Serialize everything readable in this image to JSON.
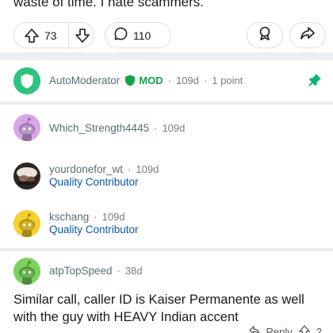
{
  "post": {
    "text_tail": "waste of time. I hate scammers.",
    "upvotes": "73",
    "comments": "110"
  },
  "comments": [
    {
      "username": "AutoModerator",
      "mod_label": "MOD",
      "age": "109d",
      "points": "1 point",
      "pinned": true
    },
    {
      "username": "Which_Strength4445",
      "age": "109d"
    },
    {
      "username": "yourdonefor_wt",
      "age": "109d",
      "flair": "Quality Contributor"
    },
    {
      "username": "kschang",
      "age": "109d",
      "flair": "Quality Contributor"
    },
    {
      "username": "atpTopSpeed",
      "age": "38d",
      "text": "Similar call, caller ID is Kaiser Permanente as well with the guy with HEAVY Indian accent"
    }
  ],
  "bottom": {
    "reply_label": "Reply",
    "vote_count": "2"
  },
  "colors": {
    "mod_green": "#17a34a",
    "flair_blue": "#0a56a8",
    "pin_green": "#0fb27a",
    "separator": "#eceff1"
  },
  "icons": [
    "upvote-icon",
    "downvote-icon",
    "comment-icon",
    "award-icon",
    "share-icon",
    "shield-icon",
    "pin-icon",
    "snoo-avatar-icon"
  ]
}
